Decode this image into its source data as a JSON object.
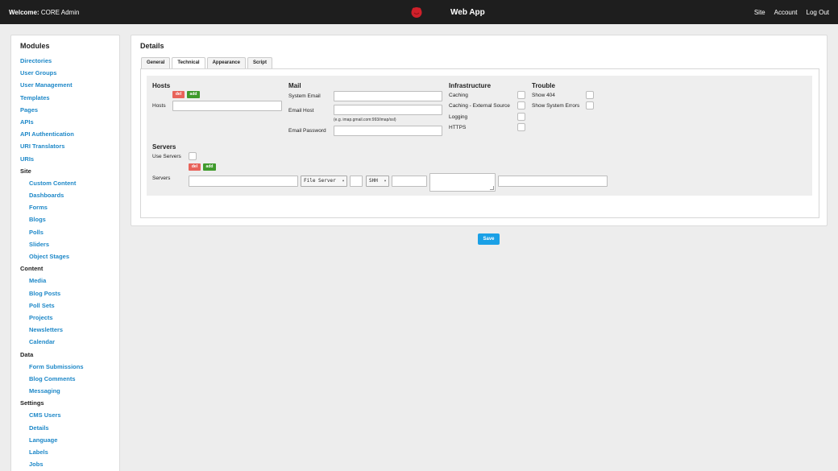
{
  "topbar": {
    "welcome_label": "Welcome:",
    "welcome_user": "CORE Admin",
    "app_title": "Web App",
    "nav": [
      "Site",
      "Account",
      "Log Out"
    ],
    "logo_icon": "app-logo-icon",
    "logo_color": "#d0202a"
  },
  "sidebar": {
    "title": "Modules",
    "items": [
      {
        "label": "Directories",
        "type": "link"
      },
      {
        "label": "User Groups",
        "type": "link"
      },
      {
        "label": "User Management",
        "type": "link"
      },
      {
        "label": "Templates",
        "type": "link"
      },
      {
        "label": "Pages",
        "type": "link"
      },
      {
        "label": "APIs",
        "type": "link"
      },
      {
        "label": "API Authentication",
        "type": "link"
      },
      {
        "label": "URI Translators",
        "type": "link"
      },
      {
        "label": "URIs",
        "type": "link"
      },
      {
        "label": "Site",
        "type": "group"
      },
      {
        "label": "Custom Content",
        "type": "sub"
      },
      {
        "label": "Dashboards",
        "type": "sub"
      },
      {
        "label": "Forms",
        "type": "sub"
      },
      {
        "label": "Blogs",
        "type": "sub"
      },
      {
        "label": "Polls",
        "type": "sub"
      },
      {
        "label": "Sliders",
        "type": "sub"
      },
      {
        "label": "Object Stages",
        "type": "sub"
      },
      {
        "label": "Content",
        "type": "group"
      },
      {
        "label": "Media",
        "type": "sub"
      },
      {
        "label": "Blog Posts",
        "type": "sub"
      },
      {
        "label": "Poll Sets",
        "type": "sub"
      },
      {
        "label": "Projects",
        "type": "sub"
      },
      {
        "label": "Newsletters",
        "type": "sub"
      },
      {
        "label": "Calendar",
        "type": "sub"
      },
      {
        "label": "Data",
        "type": "group"
      },
      {
        "label": "Form Submissions",
        "type": "sub"
      },
      {
        "label": "Blog Comments",
        "type": "sub"
      },
      {
        "label": "Messaging",
        "type": "sub"
      },
      {
        "label": "Settings",
        "type": "group"
      },
      {
        "label": "CMS Users",
        "type": "sub"
      },
      {
        "label": "Details",
        "type": "sub"
      },
      {
        "label": "Language",
        "type": "sub"
      },
      {
        "label": "Labels",
        "type": "sub"
      },
      {
        "label": "Jobs",
        "type": "sub"
      }
    ]
  },
  "main": {
    "title": "Details",
    "tabs": [
      {
        "label": "General",
        "active": false
      },
      {
        "label": "Technical",
        "active": true
      },
      {
        "label": "Appearance",
        "active": false
      },
      {
        "label": "Script",
        "active": false
      }
    ],
    "hosts": {
      "title": "Hosts",
      "del_label": "del",
      "add_label": "add",
      "field_label": "Hosts",
      "value": ""
    },
    "mail": {
      "title": "Mail",
      "system_email_label": "System Email",
      "system_email_value": "",
      "email_host_label": "Email Host",
      "email_host_value": "",
      "email_host_hint": "(e.g. imap.gmail.com:993/imap/ssl)",
      "email_password_label": "Email Password",
      "email_password_value": ""
    },
    "infrastructure": {
      "title": "Infrastructure",
      "options": [
        {
          "label": "Caching",
          "checked": false
        },
        {
          "label": "Caching - External Source",
          "checked": false
        },
        {
          "label": "Logging",
          "checked": false
        },
        {
          "label": "HTTPS",
          "checked": false
        }
      ]
    },
    "trouble": {
      "title": "Trouble",
      "options": [
        {
          "label": "Show 404",
          "checked": false
        },
        {
          "label": "Show System Errors",
          "checked": false
        }
      ]
    },
    "servers": {
      "title": "Servers",
      "use_servers_label": "Use Servers",
      "use_servers_checked": false,
      "del_label": "del",
      "add_label": "add",
      "row_label": "Servers",
      "server_type": "File Server",
      "protocol": "SHH"
    },
    "save_label": "Save"
  },
  "colors": {
    "topbar_bg": "#1e1e1e",
    "link": "#1e88c8",
    "del": "#e8635a",
    "add": "#3f9a2c",
    "save": "#1aa0e6"
  }
}
